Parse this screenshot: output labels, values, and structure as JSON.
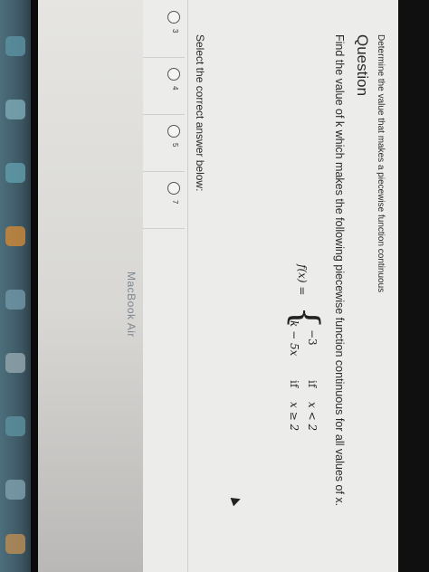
{
  "header": {
    "subtitle": "Determine the value that makes a piecewise function continuous",
    "title": "Question"
  },
  "question": {
    "text": "Find the value of k which makes the following piecewise function continuous for all values of x.",
    "function_label": "f(x) =",
    "case1_value": "−3",
    "case1_if": "if",
    "case1_condition": "x < 2",
    "case2_value": "k − 5x",
    "case2_if": "if",
    "case2_condition": "x ≥ 2"
  },
  "answers": {
    "prompt": "Select the correct answer below:",
    "options": [
      "3",
      "4",
      "5",
      "7"
    ]
  },
  "device": {
    "brand_label": "MacBook Air"
  },
  "colors": {
    "page_bg": "#ececea",
    "text": "#2b2b2b",
    "dock": "#4d6e7c"
  }
}
